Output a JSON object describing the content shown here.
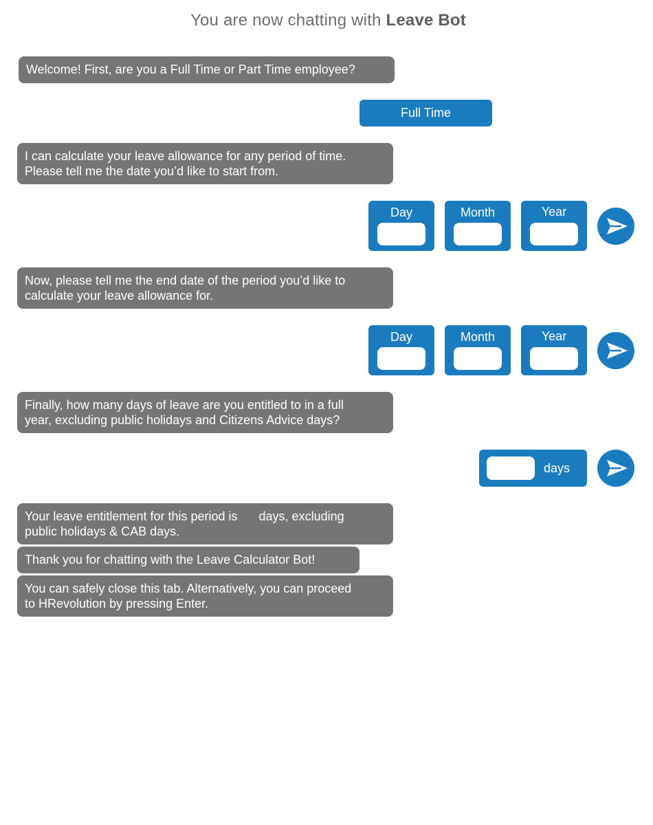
{
  "header": {
    "prefix": "You are now chatting with ",
    "bot_name": "Leave Bot"
  },
  "messages": {
    "welcome": "Welcome! First, are you a Full Time or Part Time employee?",
    "start_prompt": "I can calculate your leave allowance for any period of time.\nPlease tell me the date you’d like to start from.",
    "end_prompt": "Now, please tell me the end date of the period you’d like to\ncalculate your leave allowance for.",
    "days_prompt": "Finally, how many days of leave are you entitled to in a full\nyear, excluding public holidays and Citizens Advice days?",
    "result_before": "Your leave entitlement for this period is",
    "result_after": "days, excluding",
    "result_line2": "public holidays & CAB days.",
    "thanks": "Thank you for chatting with the Leave Calculator Bot!",
    "close": "You can safely close this tab. Alternatively, you can proceed\nto HRevolution by pressing Enter."
  },
  "user_choice": "Full Time",
  "start_date": {
    "day_label": "Day",
    "month_label": "Month",
    "year_label": "Year",
    "day_value": "",
    "month_value": "",
    "year_value": ""
  },
  "end_date": {
    "day_label": "Day",
    "month_label": "Month",
    "year_label": "Year",
    "day_value": "",
    "month_value": "",
    "year_value": ""
  },
  "days_input": {
    "value": "",
    "unit_label": "days"
  },
  "result_value": "",
  "icons": {
    "send": "send-icon"
  },
  "colors": {
    "bot_bubble": "#757575",
    "user_accent": "#1a7cbf",
    "header_text": "#6d6d6d"
  }
}
